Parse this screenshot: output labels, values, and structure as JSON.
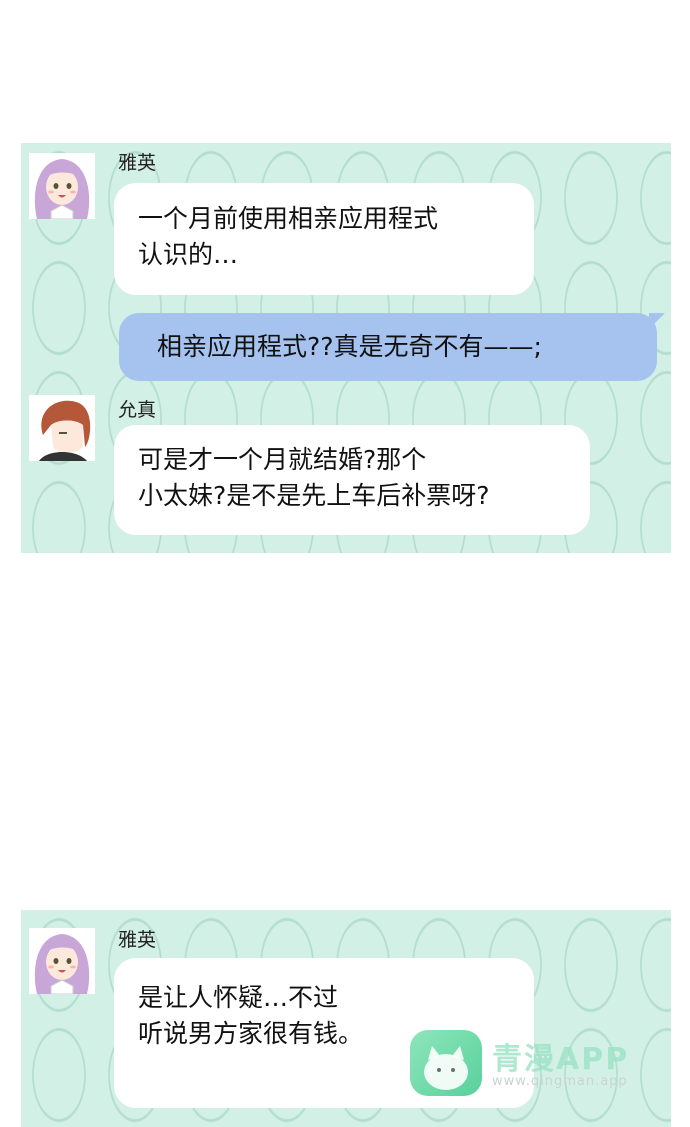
{
  "panel1": {
    "msg1": {
      "name": "雅英",
      "lines": [
        "一个月前使用相亲应用程式",
        "认识的…"
      ]
    },
    "msg2": {
      "text": "相亲应用程式??真是无奇不有——;"
    },
    "msg3": {
      "name": "允真",
      "lines": [
        "可是才一个月就结婚?那个",
        "小太妹?是不是先上车后补票呀?"
      ]
    }
  },
  "panel2": {
    "msg1": {
      "name": "雅英",
      "lines": [
        "是让人怀疑…不过",
        "听说男方家很有钱。"
      ]
    }
  },
  "watermark": {
    "title": "青漫APP",
    "url": "www.qingman.app"
  },
  "colors": {
    "panel_bg": "#d3f0e6",
    "my_bubble": "#a6c3ef",
    "other_bubble": "#ffffff",
    "avatar_hair_yaying": "#c9a6d8",
    "avatar_hair_yunzhen": "#b5583a"
  },
  "icons": {
    "avatar_yaying": "avatar-girl-purple-hair",
    "avatar_yunzhen": "avatar-boy-red-hair",
    "watermark_logo": "cat-icon"
  }
}
